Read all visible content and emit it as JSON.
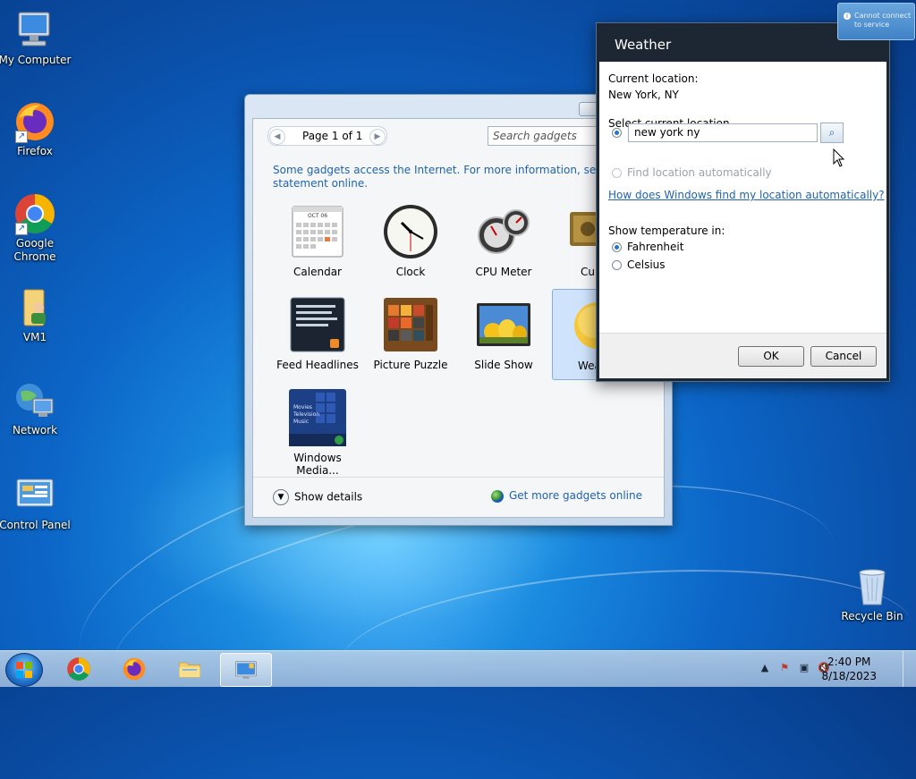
{
  "desktop": {
    "icons": [
      {
        "label": "My Computer"
      },
      {
        "label": "Firefox"
      },
      {
        "label": "Google Chrome"
      },
      {
        "label": "VM1"
      },
      {
        "label": "Network"
      },
      {
        "label": "Control Panel"
      },
      {
        "label": "Recycle Bin"
      }
    ]
  },
  "gallery": {
    "pager": "Page 1 of 1",
    "search_placeholder": "Search gadgets",
    "info_line1": "Some gadgets access the Internet.  For more information, see the pri",
    "info_line2": "statement online.",
    "calendar_month": "OCT 06",
    "gadgets": [
      {
        "label": "Calendar"
      },
      {
        "label": "Clock"
      },
      {
        "label": "CPU Meter"
      },
      {
        "label": "Curr"
      },
      {
        "label": "Feed Headlines"
      },
      {
        "label": "Picture Puzzle"
      },
      {
        "label": "Slide Show"
      },
      {
        "label": "Wea"
      },
      {
        "label": "Windows Media..."
      }
    ],
    "media_menu": [
      "Movies",
      "Television",
      "Music"
    ],
    "show_details": "Show details",
    "more_online": "Get more gadgets online"
  },
  "weather": {
    "title": "Weather",
    "current_location_label": "Current location:",
    "current_location_value": "New York, NY",
    "select_label": "Select current location",
    "location_input": "new york ny",
    "auto_label": "Find location automatically",
    "help_link": "How does Windows find my location automatically?",
    "temp_label": "Show temperature in:",
    "fahrenheit": "Fahrenheit",
    "celsius": "Celsius",
    "ok": "OK",
    "cancel": "Cancel"
  },
  "toast": {
    "line1": "Cannot connect",
    "line2": "to service"
  },
  "taskbar": {
    "time": "2:40 PM",
    "date": "8/18/2023"
  },
  "colors": {
    "link": "#1f63ad",
    "accent": "#2576c9"
  }
}
